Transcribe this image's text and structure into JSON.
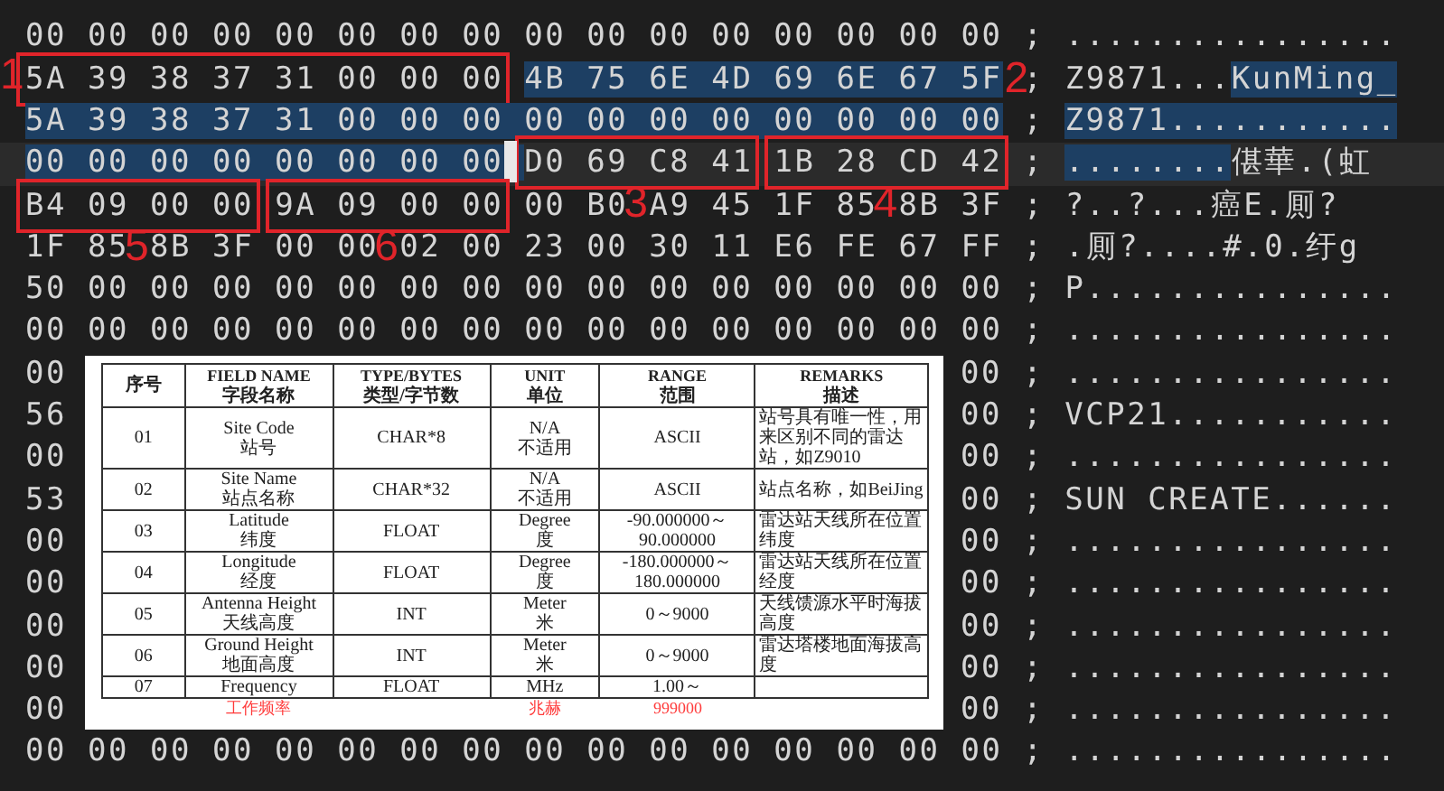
{
  "editor": {
    "rows": [
      {
        "kind": "full",
        "current": false,
        "separator": ";",
        "hex": [
          {
            "text": "00 00 00 00 00 00 00 00 00 00 00 00 00 00 00 00",
            "selected": false
          }
        ],
        "ascii": [
          {
            "text": "................",
            "selected": false
          }
        ]
      },
      {
        "kind": "full",
        "current": false,
        "separator": ";",
        "hex": [
          {
            "text": "5A 39 38 37 31 00 00 00",
            "selected": false,
            "marker": {
              "label": "1",
              "kind": "box-left"
            }
          },
          {
            "text": "4B 75 6E 4D 69 6E 67 5F",
            "selected": true,
            "marker": {
              "label": "2",
              "kind": "plain-right"
            }
          }
        ],
        "ascii": [
          {
            "text": "Z9871...",
            "selected": false
          },
          {
            "text": "KunMing_",
            "selected": true
          }
        ]
      },
      {
        "kind": "full",
        "current": false,
        "separator": ";",
        "hex": [
          {
            "text": "5A 39 38 37 31 00 00 00 00 00 00 00 00 00 00 00",
            "selected": true
          }
        ],
        "ascii": [
          {
            "text": "Z9871...........",
            "selected": true
          }
        ]
      },
      {
        "kind": "full",
        "current": true,
        "separator": ";",
        "hex": [
          {
            "text": "00 00 00 00 00 00 00 00",
            "selected": true
          },
          {
            "text": "D0 69 C8 41",
            "selected": false,
            "cursor": true,
            "marker": {
              "label": "3",
              "kind": "box-below"
            }
          },
          {
            "text": "1B 28 CD 42",
            "selected": false,
            "marker": {
              "label": "4",
              "kind": "box-below"
            }
          }
        ],
        "ascii": [
          {
            "text": "........",
            "selected": true
          },
          {
            "text": "偡華.(虹",
            "selected": false
          }
        ]
      },
      {
        "kind": "full",
        "current": false,
        "separator": ";",
        "hex": [
          {
            "text": "B4 09 00 00",
            "selected": false,
            "marker": {
              "label": "5",
              "kind": "box-below"
            }
          },
          {
            "text": "9A 09 00 00",
            "selected": false,
            "marker": {
              "label": "6",
              "kind": "box-below"
            }
          },
          {
            "text": "00 B0",
            "selected": false
          },
          {
            "text": "A9 45 1F 85",
            "selected": false
          },
          {
            "text": "8B 3F",
            "selected": false
          }
        ],
        "ascii": [
          {
            "text": "?..?...癌E.厠?",
            "selected": false
          }
        ]
      },
      {
        "kind": "full",
        "current": false,
        "separator": ";",
        "hex": [
          {
            "text": "1F 85",
            "selected": false
          },
          {
            "text": "8B 3F 00 00",
            "selected": false
          },
          {
            "text": "02 00 23 00 30 11 E6 FE 67 FF",
            "selected": false
          }
        ],
        "ascii": [
          {
            "text": ".厠?....#.0.纡g",
            "selected": false
          }
        ]
      },
      {
        "kind": "full",
        "current": false,
        "separator": ";",
        "hex": [
          {
            "text": "50 00 00 00 00 00 00 00 00 00 00 00 00 00 00 00",
            "selected": false
          }
        ],
        "ascii": [
          {
            "text": "P...............",
            "selected": false
          }
        ]
      },
      {
        "kind": "full",
        "current": false,
        "separator": ";",
        "hex": [
          {
            "text": "00 00 00 00 00 00 00 00 00 00 00 00 00 00 00 00",
            "selected": false
          }
        ],
        "ascii": [
          {
            "text": "................",
            "selected": false
          }
        ]
      },
      {
        "kind": "covered",
        "first_byte": "00",
        "last_byte": "00",
        "separator": ";",
        "ascii": "................"
      },
      {
        "kind": "covered",
        "first_byte": "56",
        "last_byte": "00",
        "separator": ";",
        "ascii": "VCP21..........."
      },
      {
        "kind": "covered",
        "first_byte": "00",
        "last_byte": "00",
        "separator": ";",
        "ascii": "................"
      },
      {
        "kind": "covered",
        "first_byte": "53",
        "last_byte": "00",
        "separator": ";",
        "ascii": "SUN CREATE......"
      },
      {
        "kind": "covered",
        "first_byte": "00",
        "last_byte": "00",
        "separator": ";",
        "ascii": "................"
      },
      {
        "kind": "covered",
        "first_byte": "00",
        "last_byte": "00",
        "separator": ";",
        "ascii": "................"
      },
      {
        "kind": "covered",
        "first_byte": "00",
        "last_byte": "00",
        "separator": ";",
        "ascii": "................"
      },
      {
        "kind": "covered",
        "first_byte": "00",
        "last_byte": "00",
        "separator": ";",
        "ascii": "................"
      },
      {
        "kind": "covered",
        "first_byte": "00",
        "last_byte": "00",
        "separator": ";",
        "ascii": "................"
      },
      {
        "kind": "full",
        "current": false,
        "separator": ";",
        "hex": [
          {
            "text": "00 00 00 00 00 00 00 00 00 00 00 00 00 00 00 00",
            "selected": false
          }
        ],
        "ascii": [
          {
            "text": "................",
            "selected": false
          }
        ]
      }
    ]
  },
  "overlay_table": {
    "columns": [
      {
        "zh": "序号"
      },
      {
        "en": "FIELD NAME",
        "zh": "字段名称"
      },
      {
        "en": "TYPE/BYTES",
        "zh": "类型/字节数"
      },
      {
        "en": "UNIT",
        "zh": "单位"
      },
      {
        "en": "RANGE",
        "zh": "范围"
      },
      {
        "en": "REMARKS",
        "zh": "描述"
      }
    ],
    "rows": [
      {
        "kind": "normal",
        "cells": [
          {
            "lines": [
              "01"
            ]
          },
          {
            "lines": [
              "Site Code",
              "站号"
            ]
          },
          {
            "lines": [
              "CHAR*8"
            ]
          },
          {
            "lines": [
              "N/A",
              "不适用"
            ]
          },
          {
            "lines": [
              "ASCII"
            ]
          },
          {
            "lines": [
              "站号具有唯一性，用来区别不同的雷达站，如Z9010"
            ]
          }
        ]
      },
      {
        "kind": "normal",
        "cells": [
          {
            "lines": [
              "02"
            ]
          },
          {
            "lines": [
              "Site Name",
              "站点名称"
            ]
          },
          {
            "lines": [
              "CHAR*32"
            ]
          },
          {
            "lines": [
              "N/A",
              "不适用"
            ]
          },
          {
            "lines": [
              "ASCII"
            ]
          },
          {
            "lines": [
              "站点名称，如BeiJing"
            ]
          }
        ]
      },
      {
        "kind": "normal",
        "cells": [
          {
            "lines": [
              "03"
            ]
          },
          {
            "lines": [
              "Latitude",
              "纬度"
            ]
          },
          {
            "lines": [
              "FLOAT"
            ]
          },
          {
            "lines": [
              "Degree",
              "度"
            ]
          },
          {
            "lines": [
              "-90.000000～",
              "90.000000"
            ]
          },
          {
            "lines": [
              "雷达站天线所在位置纬度"
            ]
          }
        ]
      },
      {
        "kind": "normal",
        "cells": [
          {
            "lines": [
              "04"
            ]
          },
          {
            "lines": [
              "Longitude",
              "经度"
            ]
          },
          {
            "lines": [
              "FLOAT"
            ]
          },
          {
            "lines": [
              "Degree",
              "度"
            ]
          },
          {
            "lines": [
              "-180.000000～",
              "180.000000"
            ]
          },
          {
            "lines": [
              "雷达站天线所在位置经度"
            ]
          }
        ]
      },
      {
        "kind": "normal",
        "cells": [
          {
            "lines": [
              "05"
            ]
          },
          {
            "lines": [
              "Antenna Height",
              "天线高度"
            ]
          },
          {
            "lines": [
              "INT"
            ]
          },
          {
            "lines": [
              "Meter",
              "米"
            ]
          },
          {
            "lines": [
              "0～9000"
            ]
          },
          {
            "lines": [
              "天线馈源水平时海拔高度"
            ]
          }
        ]
      },
      {
        "kind": "normal",
        "cells": [
          {
            "lines": [
              "06"
            ]
          },
          {
            "lines": [
              "Ground Height",
              "地面高度"
            ]
          },
          {
            "lines": [
              "INT"
            ]
          },
          {
            "lines": [
              "Meter",
              "米"
            ]
          },
          {
            "lines": [
              "0～9000"
            ]
          },
          {
            "lines": [
              "雷达塔楼地面海拔高度"
            ]
          }
        ]
      },
      {
        "kind": "cut",
        "cells": [
          {
            "lines": [
              "07"
            ]
          },
          {
            "lines": [
              "Frequency",
              "工作频率"
            ]
          },
          {
            "lines": [
              "FLOAT"
            ]
          },
          {
            "lines": [
              "MHz",
              "兆赫"
            ]
          },
          {
            "lines": [
              "1.00～",
              "999000"
            ]
          }
        ]
      }
    ]
  }
}
